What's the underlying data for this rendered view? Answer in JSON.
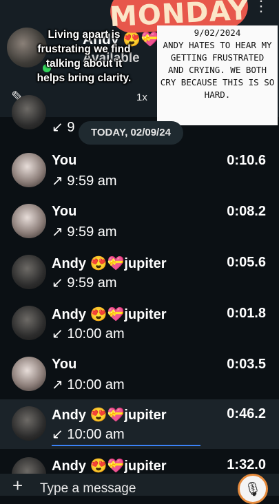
{
  "sticker": {
    "text": "MONDAY"
  },
  "header": {
    "contact_name": "Andy 😍💝jupiter",
    "status": "Available",
    "speed": "1x"
  },
  "overlay_caption": "Living apart is frustrating we find talking about it helps bring clarity.",
  "note": {
    "date": "9/02/2024",
    "lines": [
      "ANDY HATES TO HEAR MY",
      "GETTING FRUSTRATED",
      "AND CRYING. WE BOTH",
      "CRY BECAUSE THIS IS SO",
      "HARD."
    ]
  },
  "partial_row": {
    "direction": "↙ 9"
  },
  "date_chip": "TODAY, 02/09/24",
  "calls": [
    {
      "name": "You",
      "direction": "↗ 9:59 am",
      "duration": "0:10.6",
      "avatar": "you"
    },
    {
      "name": "You",
      "direction": "↗ 9:59 am",
      "duration": "0:08.2",
      "avatar": "you"
    },
    {
      "name": "Andy 😍💝jupiter",
      "direction": "↙ 9:59 am",
      "duration": "0:05.6",
      "avatar": "andy"
    },
    {
      "name": "Andy 😍💝jupiter",
      "direction": "↙ 10:00 am",
      "duration": "0:01.8",
      "avatar": "andy"
    },
    {
      "name": "You",
      "direction": "↗ 10:00 am",
      "duration": "0:03.5",
      "avatar": "you"
    },
    {
      "name": "Andy 😍💝jupiter",
      "direction": "↙ 10:00 am",
      "duration": "0:46.2",
      "avatar": "andy"
    },
    {
      "name": "Andy 😍💝jupiter",
      "direction": "",
      "duration": "1:32.0",
      "avatar": "andy"
    }
  ],
  "input": {
    "placeholder": "Type a message"
  },
  "icons": {
    "more": "more-vertical-icon",
    "edit": "pencil-icon",
    "add": "plus-icon",
    "mic": "microphone-icon"
  }
}
